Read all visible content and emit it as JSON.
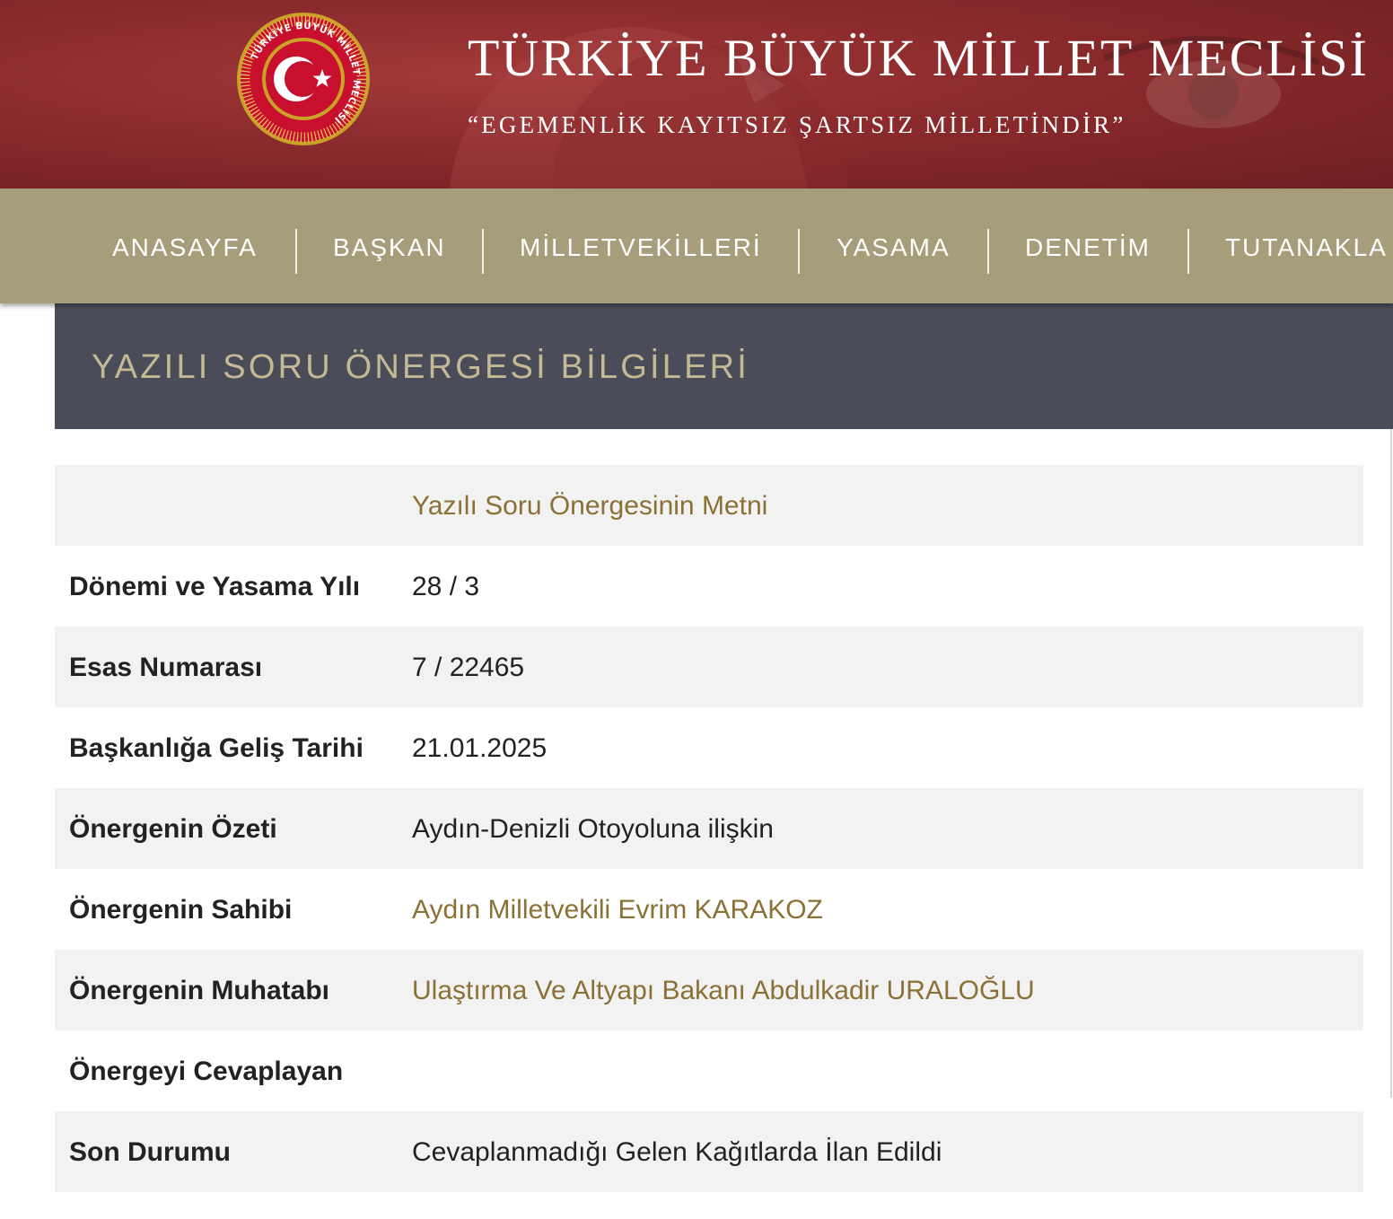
{
  "banner": {
    "title": "TÜRKİYE BÜYÜK MİLLET MECLİSİ",
    "motto": "“EGEMENLİK KAYITSIZ ŞARTSIZ MİLLETİNDİR”",
    "logo_text": "TÜRKİYE BÜYÜK MİLLET MECLİSİ",
    "colors": {
      "background": "#8a2a2c",
      "text": "#ffffff",
      "logo_gold": "#c9a227",
      "logo_red": "#c8102e"
    }
  },
  "nav": {
    "items": [
      "ANASAYFA",
      "BAŞKAN",
      "MİLLETVEKİLLERİ",
      "YASAMA",
      "DENETİM",
      "TUTANAKLA"
    ],
    "colors": {
      "background": "#a69d7b",
      "text": "#ffffff"
    }
  },
  "page": {
    "heading": "YAZILI SORU ÖNERGESİ BİLGİLERİ",
    "colors": {
      "heading_bg": "#4a4d59",
      "heading_text": "#c4b994",
      "link": "#8a7135",
      "row_shade": "#f2f2f2"
    }
  },
  "details": {
    "text_link": "Yazılı Soru Önergesinin Metni",
    "rows": [
      {
        "label": "Dönemi ve Yasama Yılı",
        "value": "28 / 3"
      },
      {
        "label": "Esas Numarası",
        "value": "7 / 22465"
      },
      {
        "label": "Başkanlığa Geliş Tarihi",
        "value": "21.01.2025"
      },
      {
        "label": "Önergenin Özeti",
        "value": "Aydın-Denizli Otoyoluna ilişkin"
      },
      {
        "label": "Önergenin Sahibi",
        "value": "Aydın Milletvekili Evrim KARAKOZ"
      },
      {
        "label": "Önergenin Muhatabı",
        "value": "Ulaştırma Ve Altyapı Bakanı Abdulkadir URALOĞLU"
      },
      {
        "label": "Önergeyi Cevaplayan",
        "value": ""
      },
      {
        "label": "Son Durumu",
        "value": "Cevaplanmadığı Gelen Kağıtlarda İlan Edildi"
      }
    ]
  }
}
